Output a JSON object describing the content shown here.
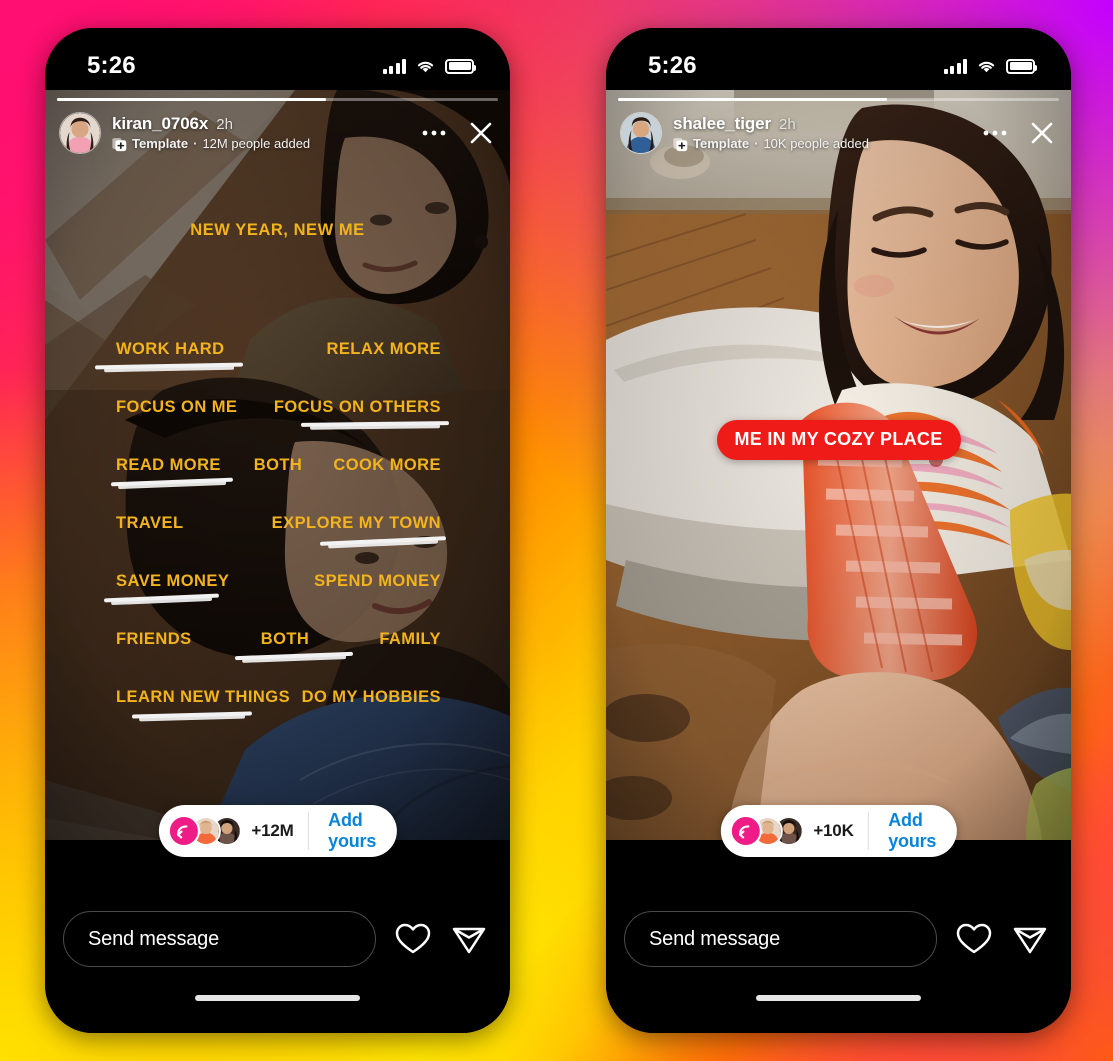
{
  "meta": {
    "app": "Instagram Stories",
    "accent_blue": "#0a84d8",
    "accent_pink": "#ef1b86",
    "accent_red": "#ef1b19",
    "poll_text_color": "#f3b31c",
    "background_gradient": [
      "#ff0a6c",
      "#ff8a00",
      "#ffe600",
      "#d400f0"
    ]
  },
  "phones": [
    {
      "id": "left",
      "status_bar": {
        "clock": "5:26",
        "signal_icon": "signal-bars-icon",
        "wifi_icon": "wifi-icon",
        "battery_icon": "battery-icon"
      },
      "story": {
        "progress_percent": 61,
        "header": {
          "avatar_icon": "avatar",
          "username": "kiran_0706x",
          "timestamp": "2h",
          "badge_icon": "template-icon",
          "badge_label": "Template",
          "separator": "·",
          "added_count": "12M people added",
          "more_icon": "more-options-icon",
          "close_icon": "close-icon"
        },
        "overlay": {
          "type": "text-list",
          "title": "NEW YEAR, NEW ME",
          "rows": [
            {
              "left": "WORK HARD",
              "middle": null,
              "right": "RELAX MORE",
              "marked": "left"
            },
            {
              "left": "FOCUS ON ME",
              "middle": null,
              "right": "FOCUS ON OTHERS",
              "marked": "right"
            },
            {
              "left": "READ MORE",
              "middle": "BOTH",
              "right": "COOK MORE",
              "marked": "left"
            },
            {
              "left": "TRAVEL",
              "middle": null,
              "right": "EXPLORE MY TOWN",
              "marked": "right"
            },
            {
              "left": "SAVE MONEY",
              "middle": null,
              "right": "SPEND MONEY",
              "marked": "left"
            },
            {
              "left": "FRIENDS",
              "middle": "BOTH",
              "right": "FAMILY",
              "marked": "middle"
            },
            {
              "left": "LEARN NEW THINGS",
              "middle": null,
              "right": "DO MY HOBBIES",
              "marked": "left"
            }
          ]
        },
        "add_yours": {
          "reply_icon": "reply-arrow-icon",
          "count": "+12M",
          "cta": "Add yours"
        }
      },
      "message_bar": {
        "placeholder": "Send message",
        "like_icon": "heart-icon",
        "share_icon": "send-paper-plane-icon"
      }
    },
    {
      "id": "right",
      "status_bar": {
        "clock": "5:26",
        "signal_icon": "signal-bars-icon",
        "wifi_icon": "wifi-icon",
        "battery_icon": "battery-icon"
      },
      "story": {
        "progress_percent": 61,
        "header": {
          "avatar_icon": "avatar",
          "username": "shalee_tiger",
          "timestamp": "2h",
          "badge_icon": "template-icon",
          "badge_label": "Template",
          "separator": "·",
          "added_count": "10K people added",
          "more_icon": "more-options-icon",
          "close_icon": "close-icon"
        },
        "overlay": {
          "type": "caption-badge",
          "caption": "ME IN MY COZY PLACE"
        },
        "add_yours": {
          "reply_icon": "reply-arrow-icon",
          "count": "+10K",
          "cta": "Add yours"
        }
      },
      "message_bar": {
        "placeholder": "Send message",
        "like_icon": "heart-icon",
        "share_icon": "send-paper-plane-icon"
      }
    }
  ]
}
